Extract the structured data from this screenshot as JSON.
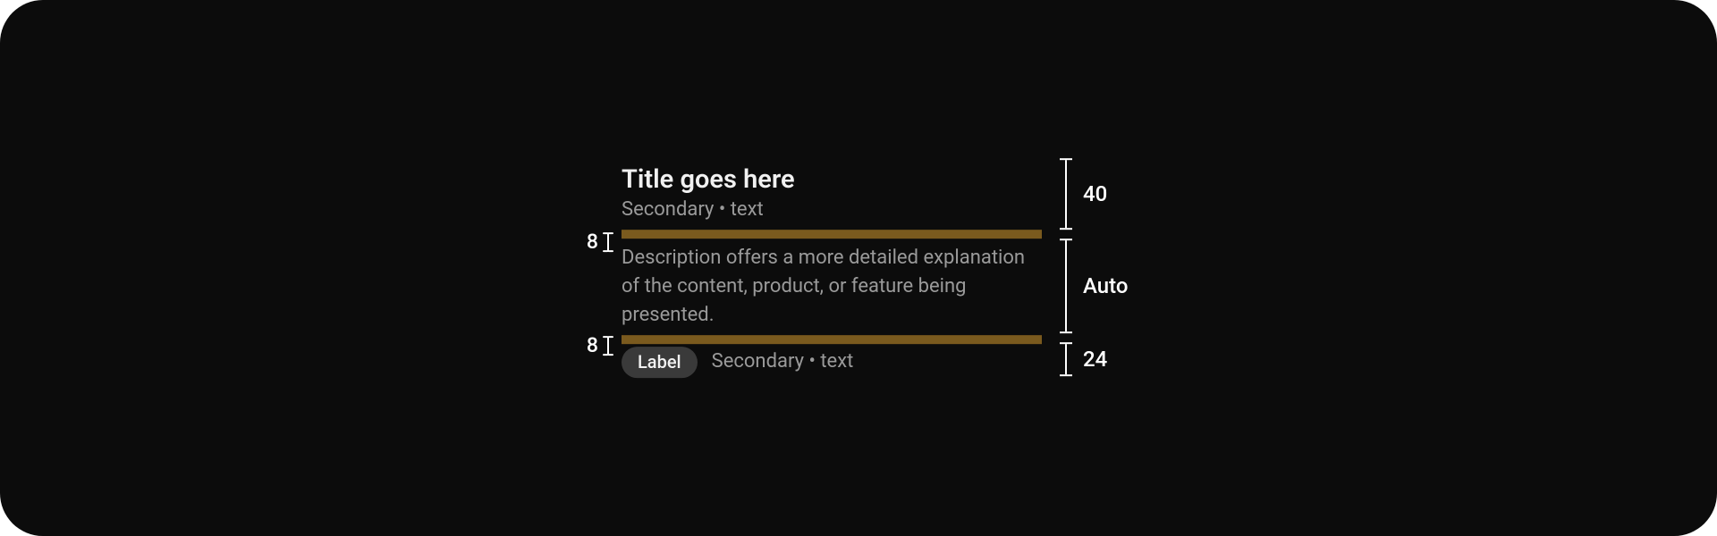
{
  "content": {
    "title": "Title goes here",
    "secondary": "Secondary • text",
    "description": "Description offers a more detailed explanation of the content, product, or feature being presented.",
    "label": "Label",
    "meta_secondary": "Secondary • text"
  },
  "annotations": {
    "spacer_top": "8",
    "spacer_bottom": "8",
    "height_header": "40",
    "height_desc": "Auto",
    "height_meta": "24"
  },
  "colors": {
    "spacer": "#7a5a1e",
    "bg": "#0c0c0c",
    "text_primary": "#f1f1f1",
    "text_secondary": "#9a9a9a",
    "pill_bg": "#3a3a3a"
  }
}
